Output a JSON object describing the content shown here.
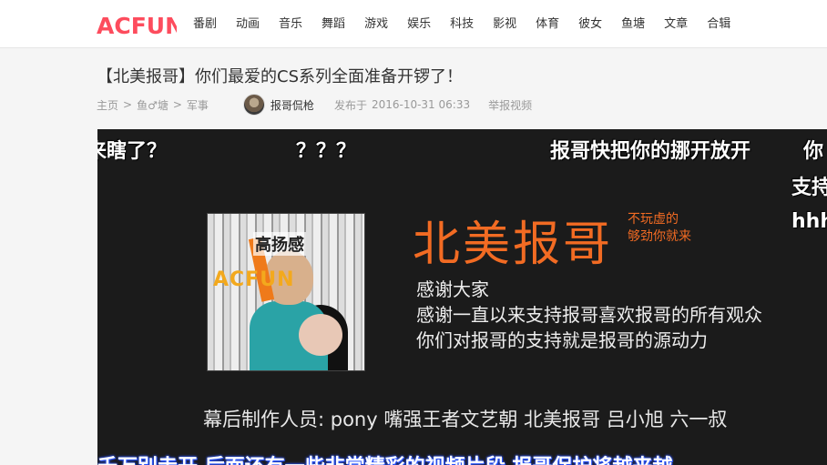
{
  "site": {
    "logo_text": "ACFUN",
    "brand_color": "#fd4c5d"
  },
  "nav": {
    "items": [
      "番剧",
      "动画",
      "音乐",
      "舞蹈",
      "游戏",
      "娱乐",
      "科技",
      "影视",
      "体育",
      "彼女",
      "鱼塘",
      "文章",
      "合辑"
    ]
  },
  "video": {
    "title": "【北美报哥】你们最爱的CS系列全面准备开锣了！",
    "breadcrumb": [
      "主页",
      "鱼♂塘",
      "军事"
    ],
    "breadcrumb_sep": ">",
    "author": "报哥侃枪",
    "published_label": "发布于",
    "published_time": "2016-10-31  06:33",
    "report_label": "举报视频"
  },
  "player": {
    "danmaku": [
      "来瞎了？",
      "？？？",
      "报哥快把你的挪开放开",
      "你",
      "支持",
      "hhh"
    ],
    "bottom_danmaku": "千万别走开 后面还有一些非常精彩的视频片段 报哥保护将越来越",
    "thumb_text_top": "高扬感",
    "thumb_text_mid": "ACFUN",
    "brand_big": "北美报哥",
    "brand_tag": [
      "不玩虚的",
      "够劲你就来"
    ],
    "thanks": [
      "感谢大家",
      "感谢一直以来支持报哥喜欢报哥的所有观众",
      "你们对报哥的支持就是报哥的源动力"
    ],
    "credits": "幕后制作人员: pony   嘴强王者文艺朝   北美报哥   吕小旭   六一叔",
    "colors": {
      "brand_orange": "#f26b23",
      "background": "#1b1b1b"
    }
  }
}
